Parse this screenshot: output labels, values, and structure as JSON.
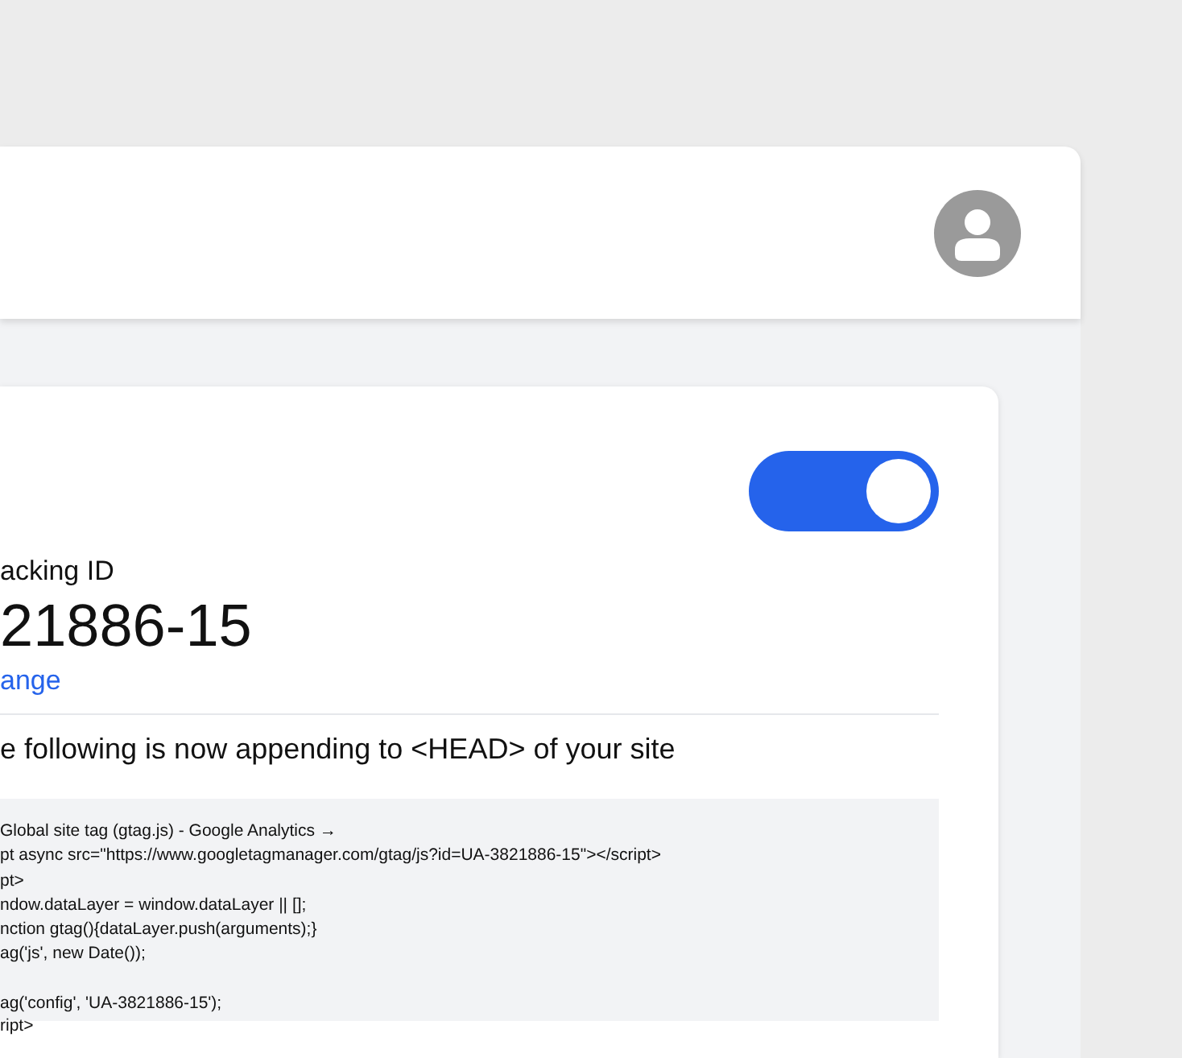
{
  "card": {
    "toggle": {
      "on": true
    },
    "label": "acking ID",
    "tracking_id": "21886-15",
    "change_link": "ange",
    "notice": "e following is now appending to <HEAD> of your site",
    "code_groups": [
      [
        "Global site tag (gtag.js) - Google Analytics →",
        "pt async src=\"https://www.googletagmanager.com/gtag/js?id=UA-3821886-15\"></script>",
        "pt>",
        "ndow.dataLayer = window.dataLayer || [];",
        "nction gtag(){dataLayer.push(arguments);}",
        "ag('js', new Date());"
      ],
      [
        "ag('config', 'UA-3821886-15');"
      ]
    ],
    "code_tail": "ript>"
  }
}
